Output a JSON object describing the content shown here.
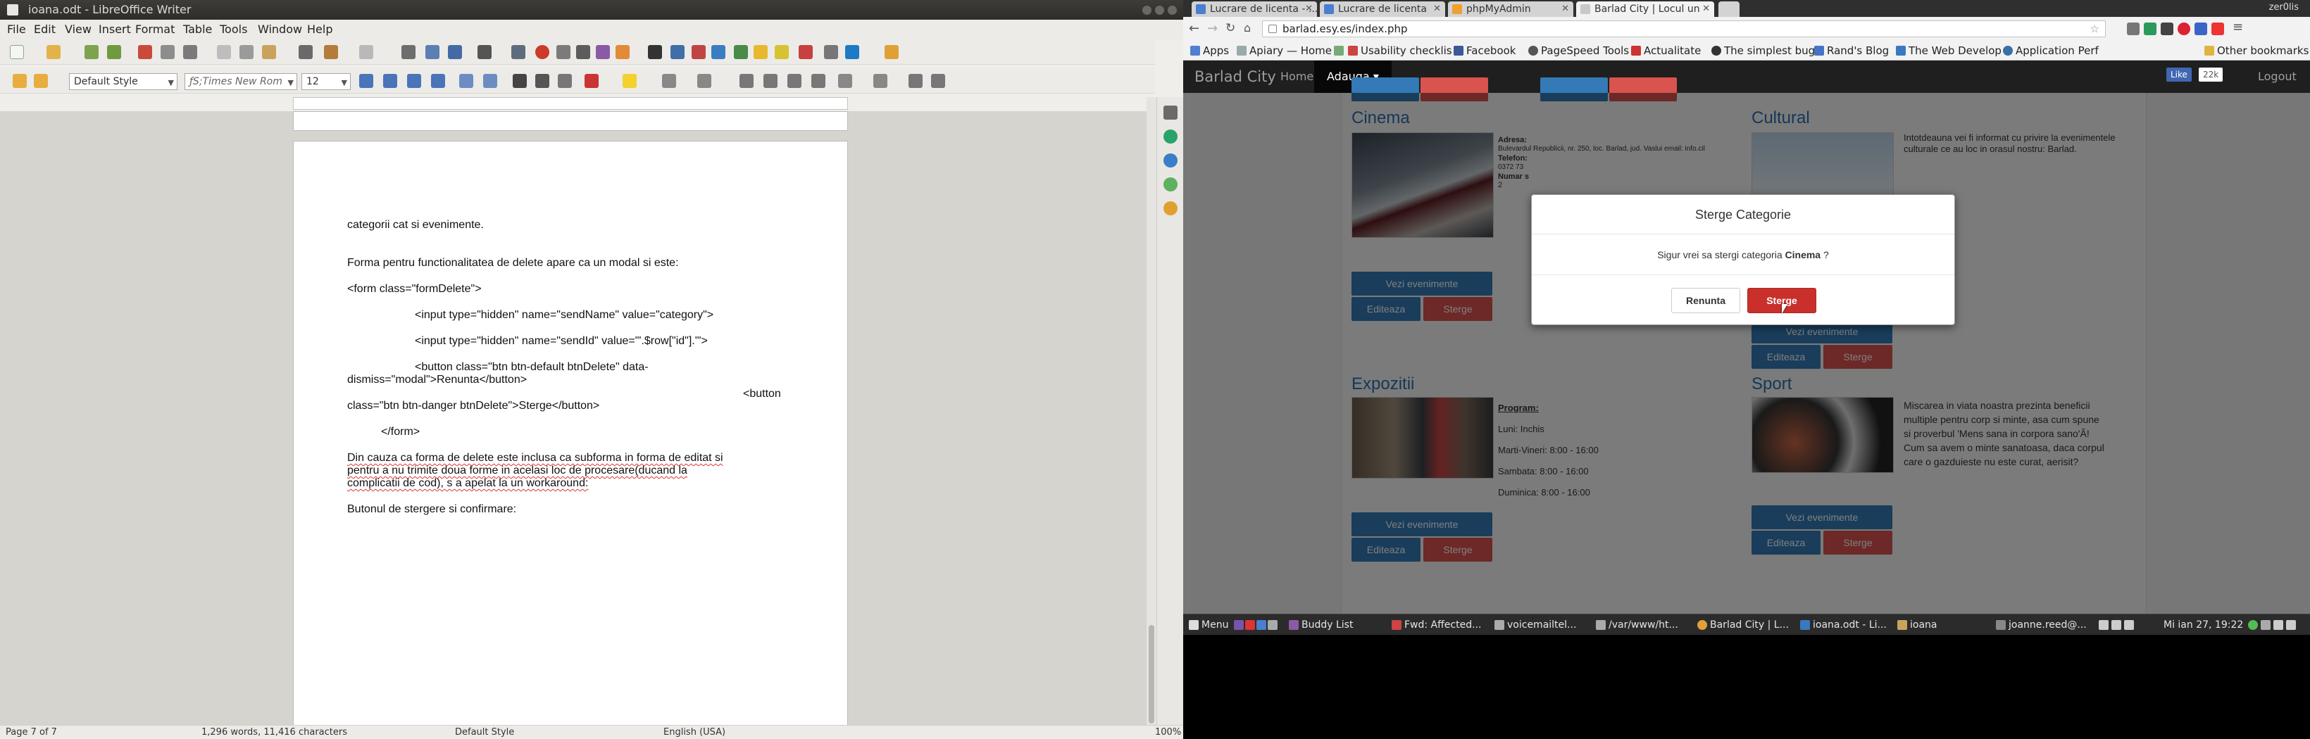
{
  "writer": {
    "window_title": "ioana.odt - LibreOffice Writer",
    "menu": [
      "File",
      "Edit",
      "View",
      "Insert",
      "Format",
      "Table",
      "Tools",
      "Window",
      "Help"
    ],
    "paragraph_style": "Default Style",
    "font_name": "ƒS;Times New Rom",
    "font_size": "12",
    "prev_page_text": "",
    "doc_lines": {
      "l1": "categorii cat si evenimente.",
      "l2": "Forma pentru functionalitatea de delete apare ca un modal si este:",
      "l3": "<form class=\"formDelete\">",
      "l4": "<input type=\"hidden\" name=\"sendName\" value=\"category\">",
      "l5": "<input type=\"hidden\" name=\"sendId\" value=\"'.$row[\"id\"].'\">",
      "l6": "<button class=\"btn btn-default btnDelete\" data-",
      "l7": "dismiss=\"modal\">Renunta</button>",
      "l8": "<button",
      "l9": "class=\"btn btn-danger btnDelete\">Sterge</button>",
      "l10": "</form>",
      "l11": "Din cauza ca forma de delete este inclusa ca subforma in forma de editat si",
      "l12": "pentru a nu trimite doua forme in acelasi loc de procesare(ducand la",
      "l13": "complicatii de cod), s a apelat la un workaround:",
      "l14": "Butonul de stergere si confirmare:"
    },
    "status": {
      "page": "Page 7 of 7",
      "words": "1,296 words, 11,416 characters",
      "style": "Default Style",
      "language": "English (USA)",
      "zoom": "100%"
    }
  },
  "chrome": {
    "tabs": [
      {
        "label": "Lucrare de licenta - ...",
        "active": false
      },
      {
        "label": "Lucrare de licenta",
        "active": false
      },
      {
        "label": "phpMyAdmin",
        "active": false
      },
      {
        "label": "Barlad City | Locul un",
        "active": true
      }
    ],
    "user": "zer0lis",
    "url": "barlad.esy.es/index.php",
    "bookmarks": [
      "Apps",
      "Apiary — Home",
      "Usability checklis",
      "Facebook",
      "PageSpeed Tools",
      "Actualitate",
      "The simplest bug",
      "Rand's Blog",
      "The Web Develop",
      "Application Perf",
      "Other bookmarks"
    ]
  },
  "site": {
    "brand": "Barlad City",
    "nav": [
      "Home",
      "Adauga ▾"
    ],
    "like_label": "Like",
    "like_count": "22k",
    "logout": "Logout",
    "categories": {
      "cinema": {
        "title": "Cinema",
        "address_label": "Adresa:",
        "address": "Bulevardul Republicii, nr. 250, loc. Barlad, jud. Vaslui email: info.cil",
        "phone_label": "Telefon:",
        "phone": "0372 73",
        "number_label": "Numar s",
        "number": "2"
      },
      "cultural": {
        "title": "Cultural",
        "desc1": "Intotdeauna vei fi informat cu privire la evenimentele",
        "desc2": "culturale ce au loc in orasul nostru: Barlad."
      },
      "expozitii": {
        "title": "Expozitii",
        "program_label": "Program:",
        "line1": "Luni: Inchis",
        "line2": "Marti-Vineri: 8:00 - 16:00",
        "line3": "Sambata: 8:00 - 16:00",
        "line4": "Duminica: 8:00 - 16:00"
      },
      "sport": {
        "title": "Sport",
        "desc1": "Miscarea in viata noastra prezinta beneficii",
        "desc2": "multiple pentru corp si minte, asa cum spune",
        "desc3": "si proverbul 'Mens sana in corpora sano'Ă!",
        "desc4": "Cum sa avem o minte sanatoasa, daca corpul",
        "desc5": "care o gazduieste nu este curat, aerisit?"
      }
    },
    "btn_view": "Vezi evenimente",
    "btn_edit": "Editeaza",
    "btn_delete": "Sterge",
    "modal": {
      "title": "Sterge Categorie",
      "body_prefix": "Sigur vrei sa stergi categoria",
      "category": "Cinema",
      "body_suffix": "?",
      "cancel": "Renunta",
      "confirm": "Sterge"
    }
  },
  "taskbar": {
    "menu": "Menu",
    "items": [
      "Buddy List",
      "Fwd: Affected...",
      "voicemailtel...",
      "/var/www/ht...",
      "Barlad City | L...",
      "ioana.odt - Li...",
      "ioana",
      "joanne.reed@..."
    ],
    "clock": "Mi ian 27, 19:22"
  },
  "colors": {
    "accent": "#337ab7",
    "danger": "#d9534f",
    "link": "#2a6fae"
  }
}
